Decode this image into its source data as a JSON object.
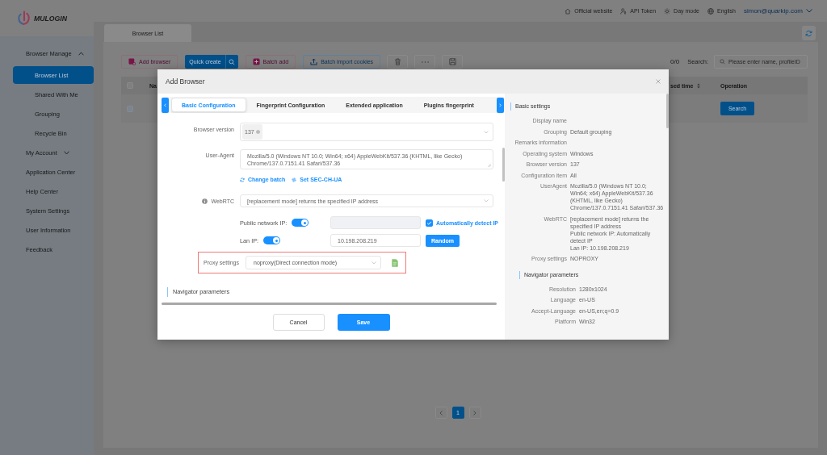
{
  "logo": {
    "text": "MULOGIN"
  },
  "header": {
    "links": [
      {
        "kind": "website",
        "label": "Official website"
      },
      {
        "kind": "token",
        "label": "API Token"
      },
      {
        "kind": "theme",
        "label": "Day mode"
      },
      {
        "kind": "language",
        "label": "English"
      }
    ],
    "user": "simon@quarkip.com"
  },
  "sidebar": {
    "items": [
      {
        "kind": "group",
        "label": "Browser Manage",
        "expanded": true,
        "selected": false,
        "children": [
          {
            "label": "Browser List",
            "selected": true
          },
          {
            "label": "Shared With Me",
            "selected": false
          },
          {
            "label": "Grouping",
            "selected": false
          },
          {
            "label": "Recycle Bin",
            "selected": false
          }
        ]
      },
      {
        "kind": "group",
        "label": "My Account",
        "expanded": false,
        "selected": false
      },
      {
        "kind": "link",
        "label": "Application Center",
        "selected": false
      },
      {
        "kind": "link",
        "label": "Help Center",
        "selected": false
      },
      {
        "kind": "link",
        "label": "System Settings",
        "selected": false
      },
      {
        "kind": "link",
        "label": "User Information",
        "selected": false
      },
      {
        "kind": "link",
        "label": "Feedback",
        "selected": false
      }
    ]
  },
  "page_tabs": [
    {
      "label": "Browser List",
      "selected": true
    }
  ],
  "toolbar": {
    "buttons": [
      {
        "kind": "add",
        "label": "Add browser"
      },
      {
        "kind": "split",
        "label": "Quick create"
      },
      {
        "kind": "batch",
        "label": "Batch add"
      },
      {
        "kind": "import",
        "label": "Batch import cookies"
      },
      {
        "kind": "delete"
      },
      {
        "kind": "more"
      },
      {
        "kind": "save"
      }
    ],
    "count": "0/0",
    "search": {
      "label": "Search:",
      "placeholder": "Please enter name, profileID"
    }
  },
  "table": {
    "select_all": {
      "checked": false
    },
    "columns": [
      {
        "label": "Na",
        "sortable": false
      },
      {
        "label": "sed time",
        "sortable": true
      },
      {
        "label": "Operation",
        "sortable": false
      }
    ],
    "rows": [
      {
        "checked": false,
        "action": "Search"
      }
    ]
  },
  "pagination": {
    "pages": [
      {
        "label": "1",
        "selected": true
      }
    ]
  },
  "dialog": {
    "title": "Add Browser",
    "tabs": [
      {
        "label": "Basic Configuration",
        "selected": true
      },
      {
        "label": "Fingerprint Configuration",
        "selected": false
      },
      {
        "label": "Extended application",
        "selected": false
      },
      {
        "label": "Plugins fingerprint",
        "selected": false
      }
    ],
    "form": {
      "browser_version": {
        "label": "Browser version",
        "tag": "137"
      },
      "user_agent": {
        "label": "User-Agent",
        "value": "Mozilla/5.0 (Windows NT 10.0; Win64; x64) AppleWebKit/537.36 (KHTML, like Gecko) Chrome/137.0.7151.41 Safari/537.36"
      },
      "links": [
        {
          "kind": "refresh",
          "label": "Change batch"
        },
        {
          "kind": "settings",
          "label": "Set SEC-CH-UA"
        }
      ],
      "webrtc": {
        "label": "WebRTC",
        "value": "[replacement mode] returns the specified IP address"
      },
      "public_ip": {
        "label": "Public network IP:",
        "on": true,
        "disabled": true,
        "auto_detect": {
          "label": "Automatically detect IP",
          "checked": true
        }
      },
      "lan_ip": {
        "label": "Lan IP:",
        "on": true,
        "value": "10.198.208.219",
        "button": "Random"
      },
      "proxy": {
        "label": "Proxy settings",
        "value": "noproxy(Direct connection mode)",
        "highlighted": true
      },
      "section": "Navigator parameters"
    },
    "buttons": [
      {
        "kind": "secondary",
        "label": "Cancel"
      },
      {
        "kind": "primary",
        "label": "Save"
      }
    ],
    "summary": [
      {
        "title": "Basic settings",
        "rows": [
          {
            "label": "Display name"
          },
          {
            "label": "Grouping",
            "values": [
              "Default grouping"
            ]
          },
          {
            "label": "Remarks information"
          },
          {
            "label": "Operating system",
            "values": [
              "Windows"
            ]
          },
          {
            "label": "Browser version",
            "values": [
              "137"
            ]
          },
          {
            "label": "Configuration item",
            "values": [
              "All"
            ]
          },
          {
            "label": "UserAgent",
            "values": [
              "Mozilla/5.0 (Windows NT 10.0; Win64; x64) AppleWebKit/537.36 (KHTML, like Gecko) Chrome/137.0.7151.41 Safari/537.36"
            ]
          },
          {
            "label": "WebRTC",
            "values": [
              "[replacement mode] returns the specified IP address",
              "Public network IP: Automatically detect IP",
              "Lan IP: 10.198.208.219"
            ]
          },
          {
            "label": "Proxy settings",
            "values": [
              "NOPROXY"
            ]
          }
        ]
      },
      {
        "title": "Navigator parameters",
        "rows": [
          {
            "label": "Resolution",
            "values": [
              "1280x1024"
            ]
          },
          {
            "label": "Language",
            "values": [
              "en-US"
            ]
          },
          {
            "label": "Accept-Language",
            "values": [
              "en-US,en;q=0.9"
            ]
          },
          {
            "label": "Platform",
            "values": [
              "Win32"
            ]
          }
        ]
      }
    ]
  }
}
